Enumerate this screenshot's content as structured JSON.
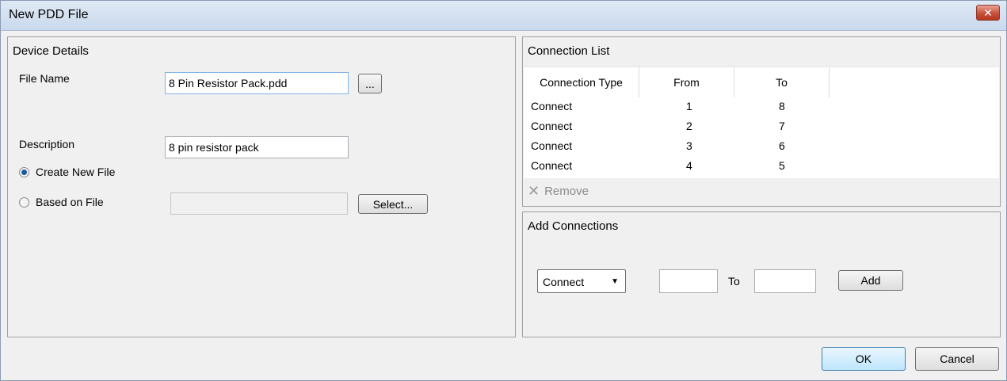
{
  "window": {
    "title": "New PDD File",
    "close_glyph": "✕"
  },
  "device_details": {
    "title": "Device Details",
    "file_name_label": "File Name",
    "file_name_value": "8 Pin Resistor Pack.pdd",
    "browse_label": "...",
    "description_label": "Description",
    "description_value": "8 pin resistor pack",
    "create_new_label": "Create New File",
    "based_on_label": "Based on File",
    "based_on_value": "",
    "select_label": "Select..."
  },
  "connection_list": {
    "title": "Connection List",
    "columns": [
      "Connection Type",
      "From",
      "To"
    ],
    "rows": [
      {
        "type": "Connect",
        "from": "1",
        "to": "8"
      },
      {
        "type": "Connect",
        "from": "2",
        "to": "7"
      },
      {
        "type": "Connect",
        "from": "3",
        "to": "6"
      },
      {
        "type": "Connect",
        "from": "4",
        "to": "5"
      }
    ],
    "remove_label": "Remove",
    "remove_icon": "✕"
  },
  "add_connections": {
    "title": "Add Connections",
    "type_value": "Connect",
    "dropdown_arrow": "▼",
    "from_value": "",
    "to_label": "To",
    "to_value": "",
    "add_label": "Add"
  },
  "footer": {
    "ok_label": "OK",
    "cancel_label": "Cancel"
  }
}
